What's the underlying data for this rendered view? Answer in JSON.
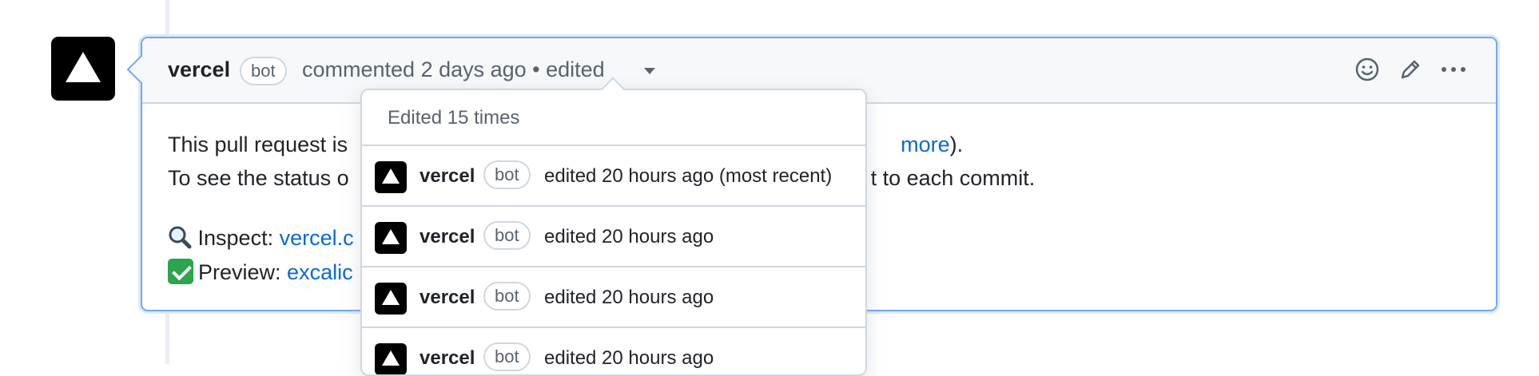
{
  "comment": {
    "author": "vercel",
    "badge": "bot",
    "meta": "commented 2 days ago • edited",
    "body": {
      "line1_start": "This pull request is",
      "line1_link": "more",
      "line1_end": ").",
      "line2_start": "To see the status o",
      "line2_end": "t to each commit.",
      "inspect_label": "Inspect:",
      "inspect_link": "vercel.c",
      "preview_label": "Preview:",
      "preview_link": "excalic"
    }
  },
  "icons": {
    "avatar": "vercel-triangle-icon",
    "emoji": "smiley-icon",
    "edit": "pencil-icon",
    "more": "kebab-horizontal-icon",
    "inspect": "magnifier-icon",
    "preview": "check-mark-icon"
  },
  "edit_history": {
    "title": "Edited 15 times",
    "items": [
      {
        "author": "vercel",
        "badge": "bot",
        "text": "edited 20 hours ago (most recent)"
      },
      {
        "author": "vercel",
        "badge": "bot",
        "text": "edited 20 hours ago"
      },
      {
        "author": "vercel",
        "badge": "bot",
        "text": "edited 20 hours ago"
      },
      {
        "author": "vercel",
        "badge": "bot",
        "text": "edited 20 hours ago"
      }
    ]
  },
  "colors": {
    "link": "#0969da",
    "focus_border": "#74a7ef",
    "check_green": "#2da44e"
  }
}
